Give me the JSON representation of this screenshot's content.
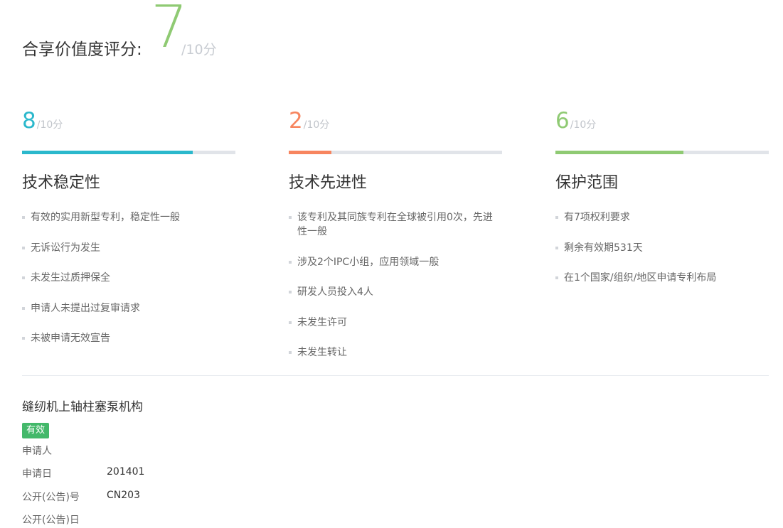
{
  "overall": {
    "label": "合享价值度评分:",
    "score": "7",
    "max": "/10分",
    "color": "#8fca73"
  },
  "dimensions": [
    {
      "score": "8",
      "max": "/10分",
      "fraction": 0.8,
      "color": "#2bb8cc",
      "title": "技术稳定性",
      "items": [
        "有效的实用新型专利，稳定性一般",
        "无诉讼行为发生",
        "未发生过质押保全",
        "申请人未提出过复审请求",
        "未被申请无效宣告"
      ]
    },
    {
      "score": "2",
      "max": "/10分",
      "fraction": 0.2,
      "color": "#f7855f",
      "title": "技术先进性",
      "items": [
        "该专利及其同族专利在全球被引用0次，先进性一般",
        "涉及2个IPC小组，应用领域一般",
        "研发人员投入4人",
        "未发生许可",
        "未发生转让"
      ]
    },
    {
      "score": "6",
      "max": "/10分",
      "fraction": 0.6,
      "color": "#8fca73",
      "title": "保护范围",
      "items": [
        "有7项权利要求",
        "剩余有效期531天",
        "在1个国家/组织/地区申请专利布局"
      ]
    }
  ],
  "patent": {
    "title": "缝纫机上轴柱塞泵机构",
    "status": "有效",
    "status_color": "#43b86a",
    "applicant_label": "申请人",
    "apply_date_label": "申请日",
    "apply_date_value": "201401",
    "pub_no_label": "公开(公告)号",
    "pub_no_value": "CN203",
    "pub_date_label": "公开(公告)日"
  }
}
